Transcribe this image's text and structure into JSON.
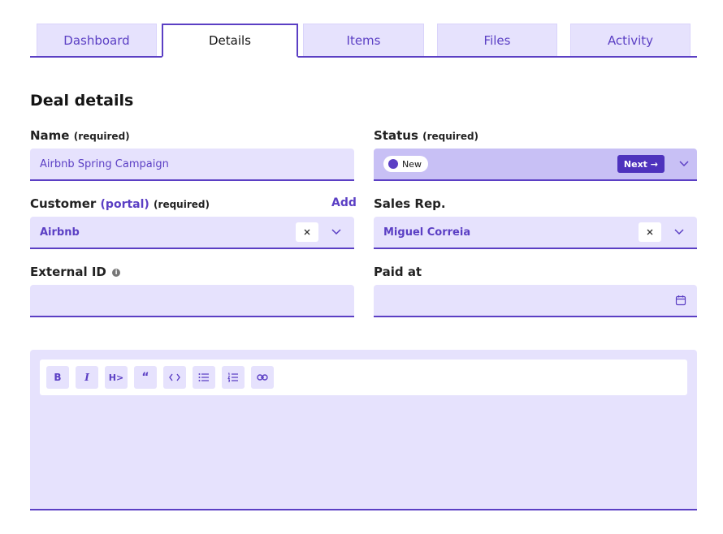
{
  "tabs": [
    {
      "label": "Dashboard"
    },
    {
      "label": "Details",
      "active": true
    },
    {
      "label": "Items"
    },
    {
      "label": "Files"
    },
    {
      "label": "Activity"
    }
  ],
  "section_title": "Deal details",
  "name": {
    "label": "Name",
    "required": "(required)",
    "value": "Airbnb Spring Campaign"
  },
  "status": {
    "label": "Status",
    "required": "(required)",
    "value": "New",
    "next_label": "Next →"
  },
  "customer": {
    "label": "Customer",
    "portal": "(portal)",
    "required": "(required)",
    "add_label": "Add",
    "value": "Airbnb"
  },
  "sales_rep": {
    "label": "Sales Rep.",
    "value": "Miguel Correia"
  },
  "external_id": {
    "label": "External ID",
    "value": ""
  },
  "paid_at": {
    "label": "Paid at",
    "value": ""
  },
  "editor": {
    "toolbar": [
      {
        "icon": "bold-icon",
        "glyph": "B"
      },
      {
        "icon": "italic-icon",
        "glyph": "I"
      },
      {
        "icon": "heading-icon",
        "glyph": "H>"
      },
      {
        "icon": "quote-icon",
        "glyph": "““"
      },
      {
        "icon": "code-icon",
        "glyph": "<>"
      },
      {
        "icon": "bullet-list-icon",
        "glyph": ""
      },
      {
        "icon": "numbered-list-icon",
        "glyph": ""
      },
      {
        "icon": "link-icon",
        "glyph": ""
      }
    ]
  },
  "colors": {
    "accent": "#5b3fc4",
    "field_bg": "#e6e2fd",
    "status_bg": "#c8c0f5"
  }
}
